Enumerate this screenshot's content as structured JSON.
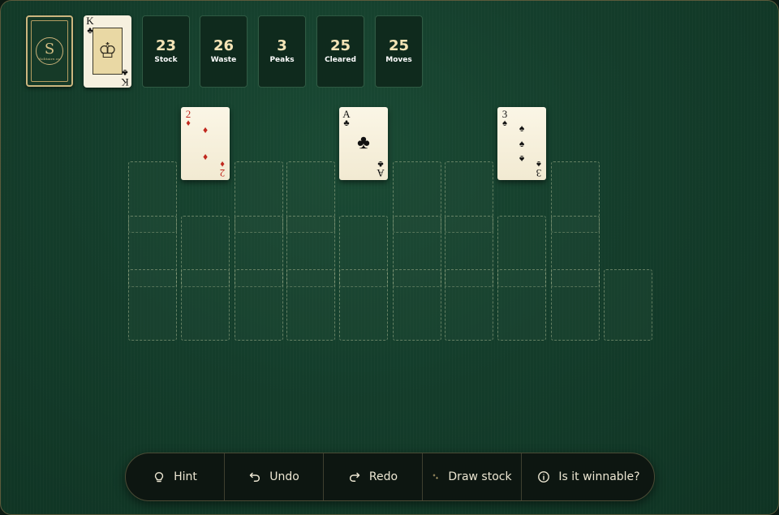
{
  "stock": {
    "brand": "Solitaire.co"
  },
  "waste": {
    "rank": "K",
    "suit": "♣",
    "suit_color": "black"
  },
  "stats": [
    {
      "value": "23",
      "label": "Stock"
    },
    {
      "value": "26",
      "label": "Waste"
    },
    {
      "value": "3",
      "label": "Peaks"
    },
    {
      "value": "25",
      "label": "Cleared"
    },
    {
      "value": "25",
      "label": "Moves"
    }
  ],
  "peaks": [
    {
      "rank": "2",
      "suit": "♦",
      "suit_color": "red"
    },
    {
      "rank": "A",
      "suit": "♣",
      "suit_color": "black"
    },
    {
      "rank": "3",
      "suit": "♠",
      "suit_color": "black"
    }
  ],
  "toolbar": {
    "hint": "Hint",
    "undo": "Undo",
    "redo": "Redo",
    "draw_stock": "Draw stock",
    "winnable": "Is it winnable?"
  },
  "colors": {
    "felt": "#143d2b",
    "gold": "#cbb67f",
    "red_suit": "#c0281e"
  }
}
